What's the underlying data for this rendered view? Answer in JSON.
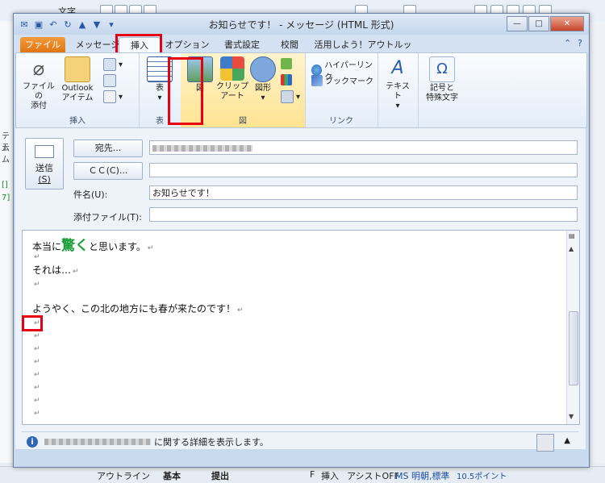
{
  "window": {
    "title": "お知らせです！ - メッセージ (HTML 形式)",
    "minimize": "—",
    "maximize": "□",
    "close": "✕"
  },
  "tabs": [
    "ファイル",
    "メッセージ",
    "挿入",
    "オプション",
    "書式設定",
    "校閲",
    "活用しよう！アウトルック"
  ],
  "ribbon": {
    "insert_group": {
      "label": "挿入",
      "attach_file": "ファイルの\n添付",
      "outlook_item": "Outlook\nアイテム"
    },
    "table_group": {
      "label": "表",
      "table": "表"
    },
    "figure_group": {
      "label": "図",
      "picture": "図",
      "clipart": "クリップ\nアート",
      "shapes": "図形"
    },
    "link_group": {
      "label": "リンク",
      "hyperlink": "ハイパーリンク",
      "bookmark": "ブックマーク"
    },
    "text_group": {
      "text": "テキスト"
    },
    "symbol_group": {
      "symbols": "記号と\n特殊文字"
    }
  },
  "compose": {
    "send_label": "送信",
    "send_accel": "(S)",
    "to_button": "宛先...",
    "cc_button": "ＣＣ(C)...",
    "subject_label": "件名(U):",
    "subject_value": "お知らせです！",
    "attach_label": "添付ファイル(T):"
  },
  "body": {
    "line1_pre": "本当に",
    "line1_emph": "驚く",
    "line1_post": "と思います。",
    "line3": "それは…",
    "line5": "ようやく、この北の地方にも春が来たのです！",
    "para_mark": "↵"
  },
  "infobar": {
    "suffix": "に関する詳細を表示します。"
  },
  "background": {
    "top_text": "文字",
    "left_labels": [
      "テム",
      "テム",
      "[]",
      "7]"
    ],
    "status": [
      "アウトライン",
      "基本",
      "提出",
      "F",
      "挿入",
      "アシストOFF",
      "MS 明朝,標準",
      "10.5ポイント"
    ]
  },
  "colors": {
    "highlight": "#e60012",
    "file_tab": "#e07612",
    "emphasis": "#1a9e3a"
  }
}
